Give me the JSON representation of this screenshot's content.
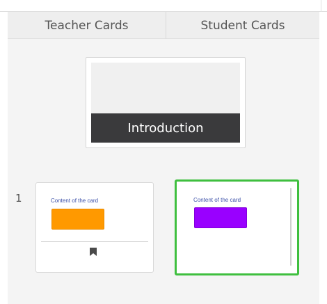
{
  "tabs": {
    "teacher_label": "Teacher Cards",
    "student_label": "Student Cards"
  },
  "intro_card": {
    "title": "Introduction"
  },
  "card_row": {
    "number": "1",
    "cards": [
      {
        "content": "Content of the card",
        "swatch_color": "#ff9900",
        "icon": "bookmark-icon"
      },
      {
        "content": "Content of the card",
        "swatch_color": "#9900ff",
        "selected": true
      }
    ]
  },
  "colors": {
    "selected_border": "#3fbf3f",
    "intro_banner": "#3a3a3c"
  }
}
